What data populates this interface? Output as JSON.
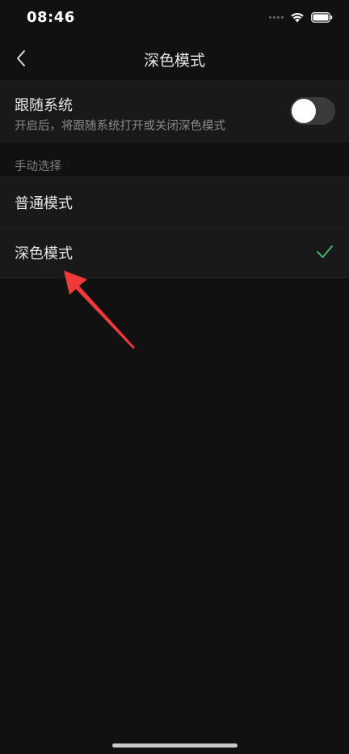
{
  "status_bar": {
    "time": "08:46",
    "icons": [
      "signal-dots-icon",
      "wifi-icon",
      "battery-icon"
    ]
  },
  "nav": {
    "back_icon": "chevron-left-icon",
    "title": "深色模式"
  },
  "follow_system": {
    "title": "跟随系统",
    "description": "开启后，将跟随系统打开或关闭深色模式",
    "toggle_on": false
  },
  "manual": {
    "section_header": "手动选择",
    "options": [
      {
        "label": "普通模式",
        "selected": false
      },
      {
        "label": "深色模式",
        "selected": true
      }
    ]
  },
  "colors": {
    "background": "#111111",
    "cell": "#191919",
    "check": "#3fb868",
    "annotation_arrow": "#f03a3a"
  }
}
